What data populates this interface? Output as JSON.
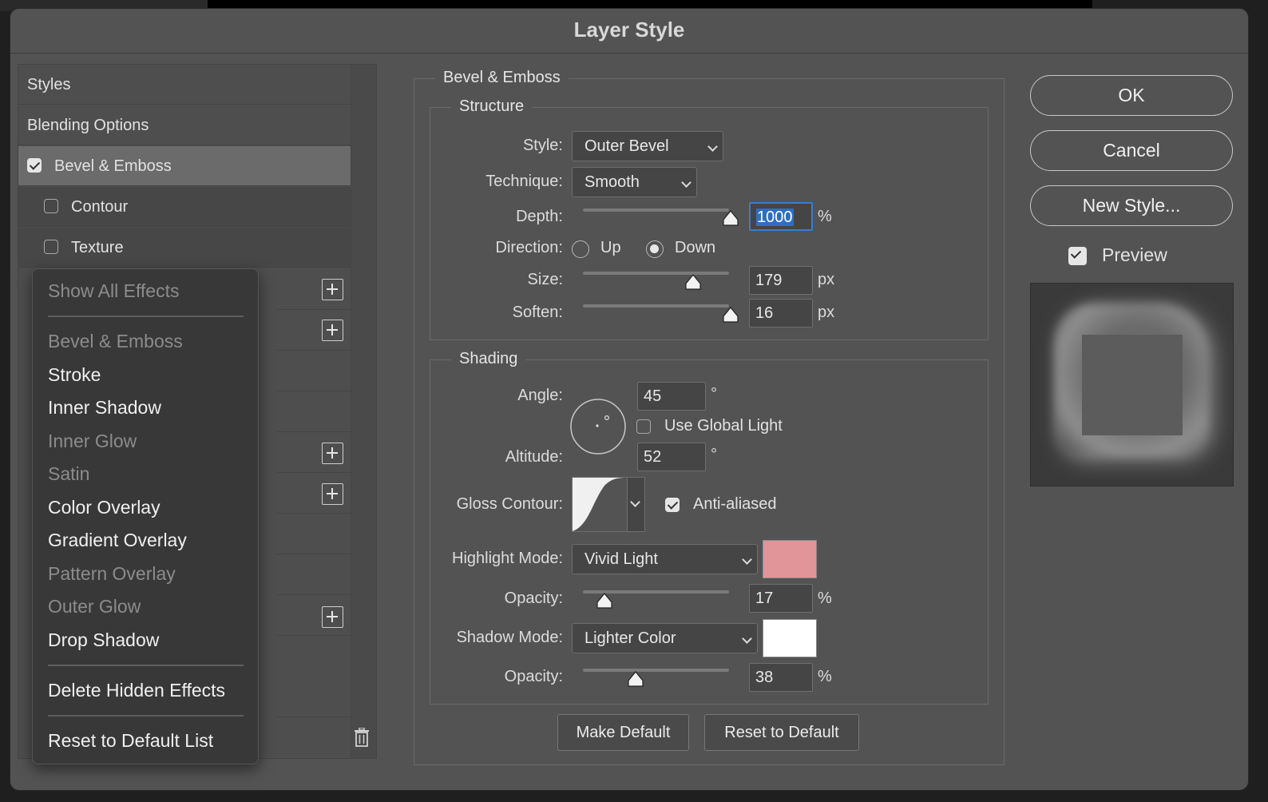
{
  "dialog": {
    "title": "Layer Style"
  },
  "effects_list": {
    "styles": "Styles",
    "blending_options": "Blending Options",
    "bevel_emboss": "Bevel & Emboss",
    "contour": "Contour",
    "texture": "Texture"
  },
  "context_menu": {
    "show_all": "Show All Effects",
    "items": [
      {
        "label": "Bevel & Emboss",
        "enabled": false
      },
      {
        "label": "Stroke",
        "enabled": true
      },
      {
        "label": "Inner Shadow",
        "enabled": true
      },
      {
        "label": "Inner Glow",
        "enabled": false
      },
      {
        "label": "Satin",
        "enabled": false
      },
      {
        "label": "Color Overlay",
        "enabled": true
      },
      {
        "label": "Gradient Overlay",
        "enabled": true
      },
      {
        "label": "Pattern Overlay",
        "enabled": false
      },
      {
        "label": "Outer Glow",
        "enabled": false
      },
      {
        "label": "Drop Shadow",
        "enabled": true
      }
    ],
    "delete_hidden": "Delete Hidden Effects",
    "reset_list": "Reset to Default List"
  },
  "bevel": {
    "section_title": "Bevel & Emboss",
    "structure": {
      "title": "Structure",
      "style_label": "Style:",
      "style_value": "Outer Bevel",
      "technique_label": "Technique:",
      "technique_value": "Smooth",
      "depth_label": "Depth:",
      "depth_value": "1000",
      "depth_unit": "%",
      "direction_label": "Direction:",
      "direction_up": "Up",
      "direction_down": "Down",
      "size_label": "Size:",
      "size_value": "179",
      "size_unit": "px",
      "soften_label": "Soften:",
      "soften_value": "16",
      "soften_unit": "px"
    },
    "shading": {
      "title": "Shading",
      "angle_label": "Angle:",
      "angle_value": "45",
      "degree": "°",
      "use_global_light": "Use Global Light",
      "altitude_label": "Altitude:",
      "altitude_value": "52",
      "gloss_contour_label": "Gloss Contour:",
      "anti_aliased": "Anti-aliased",
      "highlight_mode_label": "Highlight Mode:",
      "highlight_mode_value": "Vivid Light",
      "highlight_color": "#e29599",
      "highlight_opacity_label": "Opacity:",
      "highlight_opacity_value": "17",
      "shadow_mode_label": "Shadow Mode:",
      "shadow_mode_value": "Lighter Color",
      "shadow_color": "#ffffff",
      "shadow_opacity_label": "Opacity:",
      "shadow_opacity_value": "38",
      "percent": "%"
    },
    "make_default": "Make Default",
    "reset_default": "Reset to Default"
  },
  "actions": {
    "ok": "OK",
    "cancel": "Cancel",
    "new_style": "New Style...",
    "preview": "Preview"
  }
}
